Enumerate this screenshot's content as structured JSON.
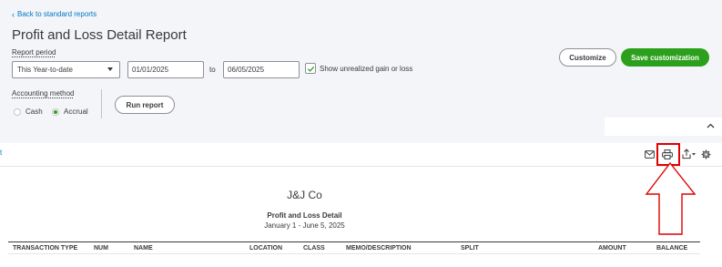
{
  "header": {
    "back_link": "Back to standard reports",
    "title": "Profit and Loss Detail Report"
  },
  "filters": {
    "report_period_label": "Report period",
    "period_value": "This Year-to-date",
    "start_date": "01/01/2025",
    "to_label": "to",
    "end_date": "06/05/2025",
    "show_unrealized_label": "Show unrealized gain or loss",
    "show_unrealized_checked": true,
    "accounting_method_label": "Accounting method",
    "cash_label": "Cash",
    "accrual_label": "Accrual",
    "selected_method": "Accrual",
    "run_report_label": "Run report"
  },
  "actions": {
    "customize_label": "Customize",
    "save_customization_label": "Save customization",
    "accent_color": "#2ca01c"
  },
  "toolbar": {
    "left_text": "t",
    "icons": [
      "email-icon",
      "print-icon",
      "export-icon",
      "settings-icon"
    ]
  },
  "report": {
    "company": "J&J Co",
    "name": "Profit and Loss Detail",
    "date_range": "January 1 - June 5, 2025",
    "columns": [
      "TRANSACTION TYPE",
      "NUM",
      "NAME",
      "LOCATION",
      "CLASS",
      "MEMO/DESCRIPTION",
      "SPLIT",
      "AMOUNT",
      "BALANCE"
    ]
  },
  "annotation": {
    "highlight_color": "#e00000"
  }
}
